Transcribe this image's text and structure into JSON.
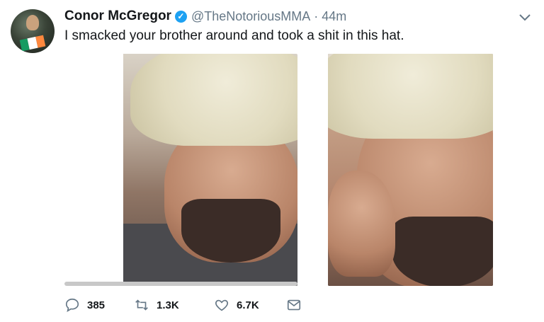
{
  "tweet": {
    "author_name": "Conor McGregor",
    "handle": "@TheNotoriousMMA",
    "separator": "·",
    "time": "44m",
    "text": "I smacked your brother around and took a shit in this hat."
  },
  "media": {
    "photos": [
      "photo-left",
      "photo-right"
    ],
    "video_progress": 0.0
  },
  "actions": {
    "replies": "385",
    "retweets": "1.3K",
    "likes": "6.7K"
  },
  "icons": {
    "verified": "verified-badge-icon",
    "menu": "chevron-down-icon",
    "reply": "reply-icon",
    "retweet": "retweet-icon",
    "like": "heart-icon",
    "message": "envelope-icon"
  },
  "colors": {
    "verified": "#1da1f2",
    "secondary_text": "#657786",
    "primary_text": "#14171a",
    "icon": "#657786"
  }
}
